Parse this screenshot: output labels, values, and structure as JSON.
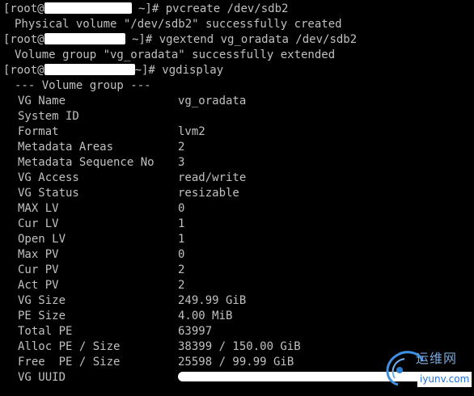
{
  "lines": {
    "l1": {
      "pre": "[root@",
      "post": " ~]# pvcreate /dev/sdb2"
    },
    "l2": "Physical volume \"/dev/sdb2\" successfully created",
    "l3": {
      "pre": "[root@",
      "post": " ~]# vgextend vg_oradata /dev/sdb2"
    },
    "l4": "Volume group \"vg_oradata\" successfully extended",
    "l5": {
      "pre": "[root@",
      "post": "~]# vgdisplay"
    },
    "section_title": "--- Volume group ---"
  },
  "vg": [
    {
      "key": "VG Name",
      "value": "vg_oradata"
    },
    {
      "key": "System ID",
      "value": ""
    },
    {
      "key": "Format",
      "value": "lvm2"
    },
    {
      "key": "Metadata Areas",
      "value": "2"
    },
    {
      "key": "Metadata Sequence No",
      "value": "3"
    },
    {
      "key": "VG Access",
      "value": "read/write"
    },
    {
      "key": "VG Status",
      "value": "resizable"
    },
    {
      "key": "MAX LV",
      "value": "0"
    },
    {
      "key": "Cur LV",
      "value": "1"
    },
    {
      "key": "Open LV",
      "value": "1"
    },
    {
      "key": "Max PV",
      "value": "0"
    },
    {
      "key": "Cur PV",
      "value": "2"
    },
    {
      "key": "Act PV",
      "value": "2"
    },
    {
      "key": "VG Size",
      "value": "249.99 GiB"
    },
    {
      "key": "PE Size",
      "value": "4.00 MiB"
    },
    {
      "key": "Total PE",
      "value": "63997"
    },
    {
      "key": "Alloc PE / Size",
      "value": "38399 / 150.00 GiB"
    },
    {
      "key": "Free  PE / Size",
      "value": "25598 / 99.99 GiB"
    },
    {
      "key": "VG UUID",
      "value": ""
    }
  ],
  "watermark": {
    "cn": "运维网",
    "en": "iyunv.com"
  }
}
